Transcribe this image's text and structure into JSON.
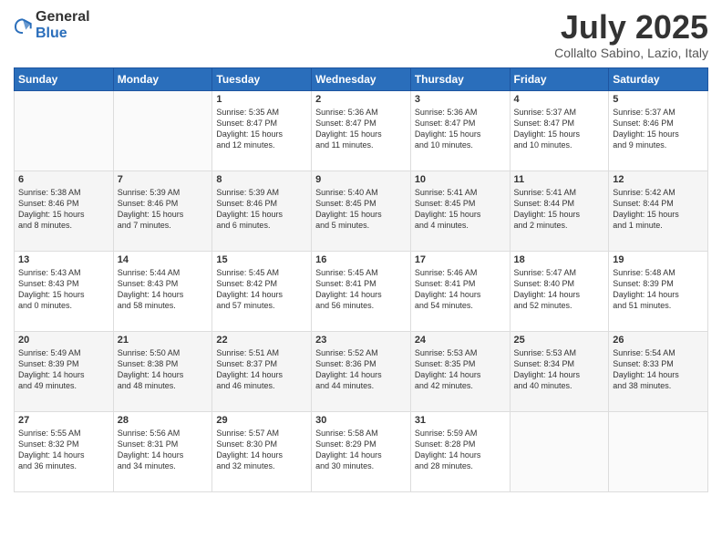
{
  "header": {
    "logo_general": "General",
    "logo_blue": "Blue",
    "month_title": "July 2025",
    "subtitle": "Collalto Sabino, Lazio, Italy"
  },
  "weekdays": [
    "Sunday",
    "Monday",
    "Tuesday",
    "Wednesday",
    "Thursday",
    "Friday",
    "Saturday"
  ],
  "rows": [
    [
      {
        "day": "",
        "lines": []
      },
      {
        "day": "",
        "lines": []
      },
      {
        "day": "1",
        "lines": [
          "Sunrise: 5:35 AM",
          "Sunset: 8:47 PM",
          "Daylight: 15 hours",
          "and 12 minutes."
        ]
      },
      {
        "day": "2",
        "lines": [
          "Sunrise: 5:36 AM",
          "Sunset: 8:47 PM",
          "Daylight: 15 hours",
          "and 11 minutes."
        ]
      },
      {
        "day": "3",
        "lines": [
          "Sunrise: 5:36 AM",
          "Sunset: 8:47 PM",
          "Daylight: 15 hours",
          "and 10 minutes."
        ]
      },
      {
        "day": "4",
        "lines": [
          "Sunrise: 5:37 AM",
          "Sunset: 8:47 PM",
          "Daylight: 15 hours",
          "and 10 minutes."
        ]
      },
      {
        "day": "5",
        "lines": [
          "Sunrise: 5:37 AM",
          "Sunset: 8:46 PM",
          "Daylight: 15 hours",
          "and 9 minutes."
        ]
      }
    ],
    [
      {
        "day": "6",
        "lines": [
          "Sunrise: 5:38 AM",
          "Sunset: 8:46 PM",
          "Daylight: 15 hours",
          "and 8 minutes."
        ]
      },
      {
        "day": "7",
        "lines": [
          "Sunrise: 5:39 AM",
          "Sunset: 8:46 PM",
          "Daylight: 15 hours",
          "and 7 minutes."
        ]
      },
      {
        "day": "8",
        "lines": [
          "Sunrise: 5:39 AM",
          "Sunset: 8:46 PM",
          "Daylight: 15 hours",
          "and 6 minutes."
        ]
      },
      {
        "day": "9",
        "lines": [
          "Sunrise: 5:40 AM",
          "Sunset: 8:45 PM",
          "Daylight: 15 hours",
          "and 5 minutes."
        ]
      },
      {
        "day": "10",
        "lines": [
          "Sunrise: 5:41 AM",
          "Sunset: 8:45 PM",
          "Daylight: 15 hours",
          "and 4 minutes."
        ]
      },
      {
        "day": "11",
        "lines": [
          "Sunrise: 5:41 AM",
          "Sunset: 8:44 PM",
          "Daylight: 15 hours",
          "and 2 minutes."
        ]
      },
      {
        "day": "12",
        "lines": [
          "Sunrise: 5:42 AM",
          "Sunset: 8:44 PM",
          "Daylight: 15 hours",
          "and 1 minute."
        ]
      }
    ],
    [
      {
        "day": "13",
        "lines": [
          "Sunrise: 5:43 AM",
          "Sunset: 8:43 PM",
          "Daylight: 15 hours",
          "and 0 minutes."
        ]
      },
      {
        "day": "14",
        "lines": [
          "Sunrise: 5:44 AM",
          "Sunset: 8:43 PM",
          "Daylight: 14 hours",
          "and 58 minutes."
        ]
      },
      {
        "day": "15",
        "lines": [
          "Sunrise: 5:45 AM",
          "Sunset: 8:42 PM",
          "Daylight: 14 hours",
          "and 57 minutes."
        ]
      },
      {
        "day": "16",
        "lines": [
          "Sunrise: 5:45 AM",
          "Sunset: 8:41 PM",
          "Daylight: 14 hours",
          "and 56 minutes."
        ]
      },
      {
        "day": "17",
        "lines": [
          "Sunrise: 5:46 AM",
          "Sunset: 8:41 PM",
          "Daylight: 14 hours",
          "and 54 minutes."
        ]
      },
      {
        "day": "18",
        "lines": [
          "Sunrise: 5:47 AM",
          "Sunset: 8:40 PM",
          "Daylight: 14 hours",
          "and 52 minutes."
        ]
      },
      {
        "day": "19",
        "lines": [
          "Sunrise: 5:48 AM",
          "Sunset: 8:39 PM",
          "Daylight: 14 hours",
          "and 51 minutes."
        ]
      }
    ],
    [
      {
        "day": "20",
        "lines": [
          "Sunrise: 5:49 AM",
          "Sunset: 8:39 PM",
          "Daylight: 14 hours",
          "and 49 minutes."
        ]
      },
      {
        "day": "21",
        "lines": [
          "Sunrise: 5:50 AM",
          "Sunset: 8:38 PM",
          "Daylight: 14 hours",
          "and 48 minutes."
        ]
      },
      {
        "day": "22",
        "lines": [
          "Sunrise: 5:51 AM",
          "Sunset: 8:37 PM",
          "Daylight: 14 hours",
          "and 46 minutes."
        ]
      },
      {
        "day": "23",
        "lines": [
          "Sunrise: 5:52 AM",
          "Sunset: 8:36 PM",
          "Daylight: 14 hours",
          "and 44 minutes."
        ]
      },
      {
        "day": "24",
        "lines": [
          "Sunrise: 5:53 AM",
          "Sunset: 8:35 PM",
          "Daylight: 14 hours",
          "and 42 minutes."
        ]
      },
      {
        "day": "25",
        "lines": [
          "Sunrise: 5:53 AM",
          "Sunset: 8:34 PM",
          "Daylight: 14 hours",
          "and 40 minutes."
        ]
      },
      {
        "day": "26",
        "lines": [
          "Sunrise: 5:54 AM",
          "Sunset: 8:33 PM",
          "Daylight: 14 hours",
          "and 38 minutes."
        ]
      }
    ],
    [
      {
        "day": "27",
        "lines": [
          "Sunrise: 5:55 AM",
          "Sunset: 8:32 PM",
          "Daylight: 14 hours",
          "and 36 minutes."
        ]
      },
      {
        "day": "28",
        "lines": [
          "Sunrise: 5:56 AM",
          "Sunset: 8:31 PM",
          "Daylight: 14 hours",
          "and 34 minutes."
        ]
      },
      {
        "day": "29",
        "lines": [
          "Sunrise: 5:57 AM",
          "Sunset: 8:30 PM",
          "Daylight: 14 hours",
          "and 32 minutes."
        ]
      },
      {
        "day": "30",
        "lines": [
          "Sunrise: 5:58 AM",
          "Sunset: 8:29 PM",
          "Daylight: 14 hours",
          "and 30 minutes."
        ]
      },
      {
        "day": "31",
        "lines": [
          "Sunrise: 5:59 AM",
          "Sunset: 8:28 PM",
          "Daylight: 14 hours",
          "and 28 minutes."
        ]
      },
      {
        "day": "",
        "lines": []
      },
      {
        "day": "",
        "lines": []
      }
    ]
  ]
}
